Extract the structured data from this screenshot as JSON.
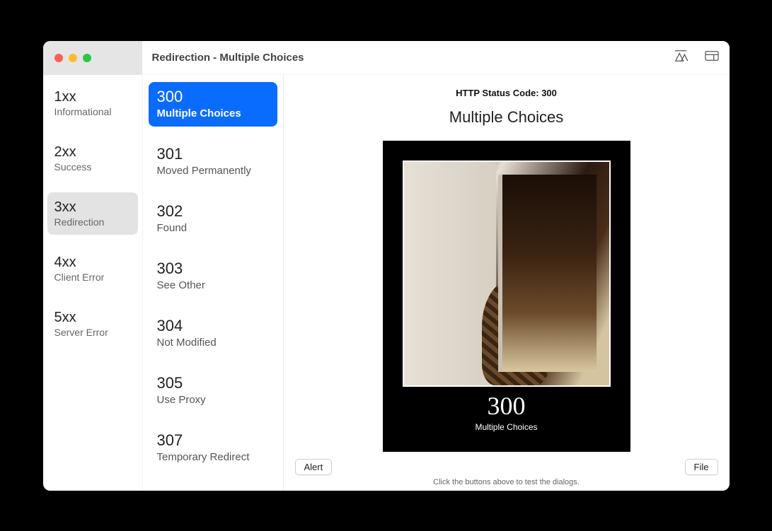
{
  "window": {
    "title": "Redirection - Multiple Choices"
  },
  "categories": [
    {
      "code": "1xx",
      "label": "Informational"
    },
    {
      "code": "2xx",
      "label": "Success"
    },
    {
      "code": "3xx",
      "label": "Redirection"
    },
    {
      "code": "4xx",
      "label": "Client Error"
    },
    {
      "code": "5xx",
      "label": "Server Error"
    }
  ],
  "selected_category_index": 2,
  "statuses": [
    {
      "code": "300",
      "label": "Multiple Choices"
    },
    {
      "code": "301",
      "label": "Moved Permanently"
    },
    {
      "code": "302",
      "label": "Found"
    },
    {
      "code": "303",
      "label": "See Other"
    },
    {
      "code": "304",
      "label": "Not Modified"
    },
    {
      "code": "305",
      "label": "Use Proxy"
    },
    {
      "code": "307",
      "label": "Temporary Redirect"
    }
  ],
  "selected_status_index": 0,
  "detail": {
    "http_line": "HTTP Status Code: 300",
    "title": "Multiple Choices",
    "poster_code": "300",
    "poster_label": "Multiple Choices"
  },
  "buttons": {
    "alert": "Alert",
    "file": "File"
  },
  "hint": "Click the buttons above to test the dialogs."
}
